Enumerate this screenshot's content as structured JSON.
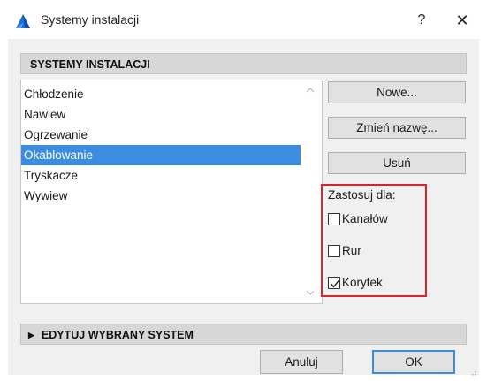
{
  "window": {
    "title": "Systemy instalacji",
    "help_label": "?",
    "close_label": "✕"
  },
  "sections": {
    "systems_header": "SYSTEMY INSTALACJI",
    "edit_header": "EDYTUJ WYBRANY SYSTEM"
  },
  "systems_list": {
    "items": [
      "Chłodzenie",
      "Nawiew",
      "Ogrzewanie",
      "Okablowanie",
      "Tryskacze",
      "Wywiew"
    ],
    "selected": "Okablowanie"
  },
  "buttons": {
    "new": "Nowe...",
    "rename": "Zmień nazwę...",
    "delete": "Usuń",
    "cancel": "Anuluj",
    "ok": "OK"
  },
  "apply_for": {
    "label": "Zastosuj dla:",
    "options": [
      {
        "label": "Kanałów",
        "checked": false
      },
      {
        "label": "Rur",
        "checked": false
      },
      {
        "label": "Korytek",
        "checked": true
      }
    ]
  },
  "colors": {
    "accent": "#3c8ce0",
    "highlight_box": "#e0202a"
  },
  "icons": {
    "app": "archicad-logo-icon",
    "expand": "triangle-right-icon",
    "scroll_up": "chevron-up-icon",
    "scroll_down": "chevron-down-icon"
  }
}
